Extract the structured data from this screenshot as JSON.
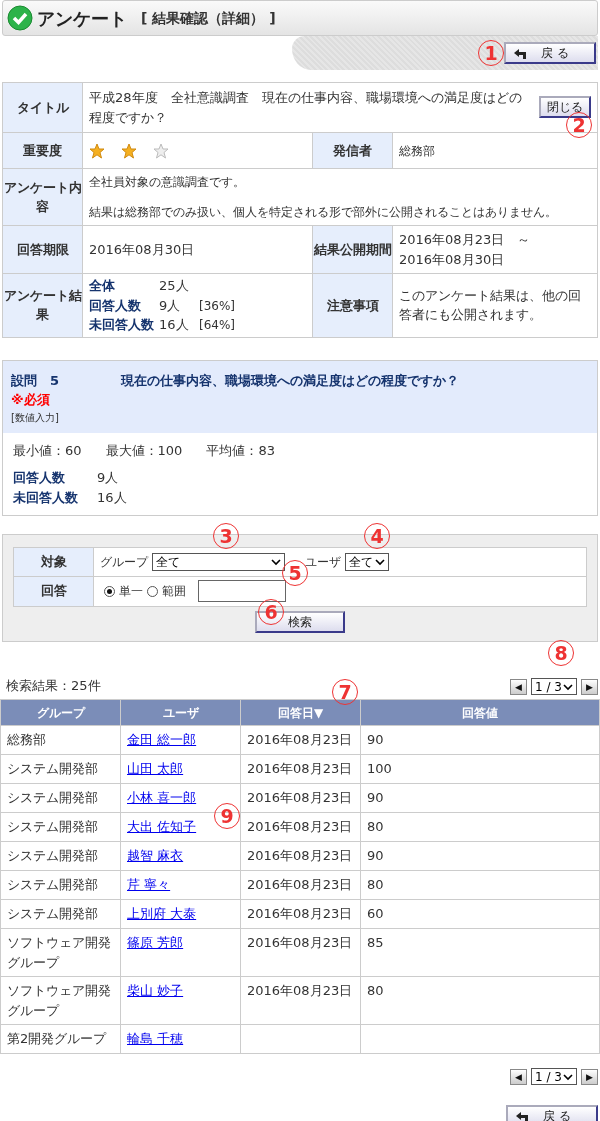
{
  "header": {
    "title": "アンケート",
    "subtitle": "[ 結果確認（詳細） ]"
  },
  "back_button": "戻 る",
  "info": {
    "title_label": "タイトル",
    "title": "平成28年度　全社意識調査　現在の仕事内容、職場環境への満足度はどの程度ですか？",
    "close_button": "閉じる",
    "importance_label": "重要度",
    "importance": {
      "stars": 2
    },
    "sender_label": "発信者",
    "sender": "総務部",
    "content_label": "アンケート内容",
    "content": [
      "全社員対象の意識調査です。",
      "結果は総務部でのみ扱い、個人を特定される形で部外に公開されることはありません。"
    ],
    "deadline_label": "回答期限",
    "deadline": "2016年08月30日",
    "publish_label": "結果公開期間",
    "publish_start": "2016年08月23日　～",
    "publish_end": "2016年08月30日",
    "result_label": "アンケート結果",
    "results": [
      {
        "label": "全体",
        "count": "25人"
      },
      {
        "label": "回答人数",
        "count": "9人",
        "percent": "[36%]"
      },
      {
        "label": "未回答人数",
        "count": "16人",
        "percent": "[64%]"
      }
    ],
    "notice_label": "注意事項",
    "notice": "このアンケート結果は、他の回答者にも公開されます。"
  },
  "question": {
    "number": "設問　5",
    "text": "現在の仕事内容、職場環境への満足度はどの程度ですか？",
    "required": "※必須",
    "type": "[数値入力]",
    "stats": [
      "最小値：60",
      "最大値：100",
      "平均値：83"
    ],
    "counts": [
      {
        "label": "回答人数",
        "value": "9人"
      },
      {
        "label": "未回答人数",
        "value": "16人"
      }
    ]
  },
  "search": {
    "target_label": "対象",
    "group_label": "グループ",
    "group_value": "全て",
    "user_label": "ユーザ",
    "user_value": "全て",
    "answer_label": "回答",
    "modes": [
      {
        "label": "単一",
        "selected": true
      },
      {
        "label": "範囲",
        "selected": false
      }
    ],
    "search_button": "検索"
  },
  "results": {
    "summary": "検索結果：25件",
    "pager": {
      "prev": "◀",
      "page": "1 / 3",
      "next": "▶"
    },
    "columns": [
      "グループ",
      "ユーザ",
      "回答日▼",
      "回答値"
    ],
    "rows": [
      [
        "総務部",
        "金田 総一郎",
        "2016年08月23日",
        "90"
      ],
      [
        "システム開発部",
        "山田 太郎",
        "2016年08月23日",
        "100"
      ],
      [
        "システム開発部",
        "小林 喜一郎",
        "2016年08月23日",
        "90"
      ],
      [
        "システム開発部",
        "大出 佐知子",
        "2016年08月23日",
        "80"
      ],
      [
        "システム開発部",
        "越智 麻衣",
        "2016年08月23日",
        "90"
      ],
      [
        "システム開発部",
        "芹 寧々",
        "2016年08月23日",
        "80"
      ],
      [
        "システム開発部",
        "上別府 大泰",
        "2016年08月23日",
        "60"
      ],
      [
        "ソフトウェア開発グループ",
        "篠原 芳郎",
        "2016年08月23日",
        "85"
      ],
      [
        "ソフトウェア開発グループ",
        "柴山 妙子",
        "2016年08月23日",
        "80"
      ],
      [
        "第2開発グループ",
        "輪島 千穂",
        "",
        ""
      ]
    ],
    "bottom_pager": {
      "prev": "◀",
      "page": "1 / 3",
      "next": "▶"
    }
  },
  "bottom_back_button": "戻 る",
  "callouts": [
    "1",
    "2",
    "3",
    "4",
    "5",
    "6",
    "7",
    "8",
    "9"
  ]
}
